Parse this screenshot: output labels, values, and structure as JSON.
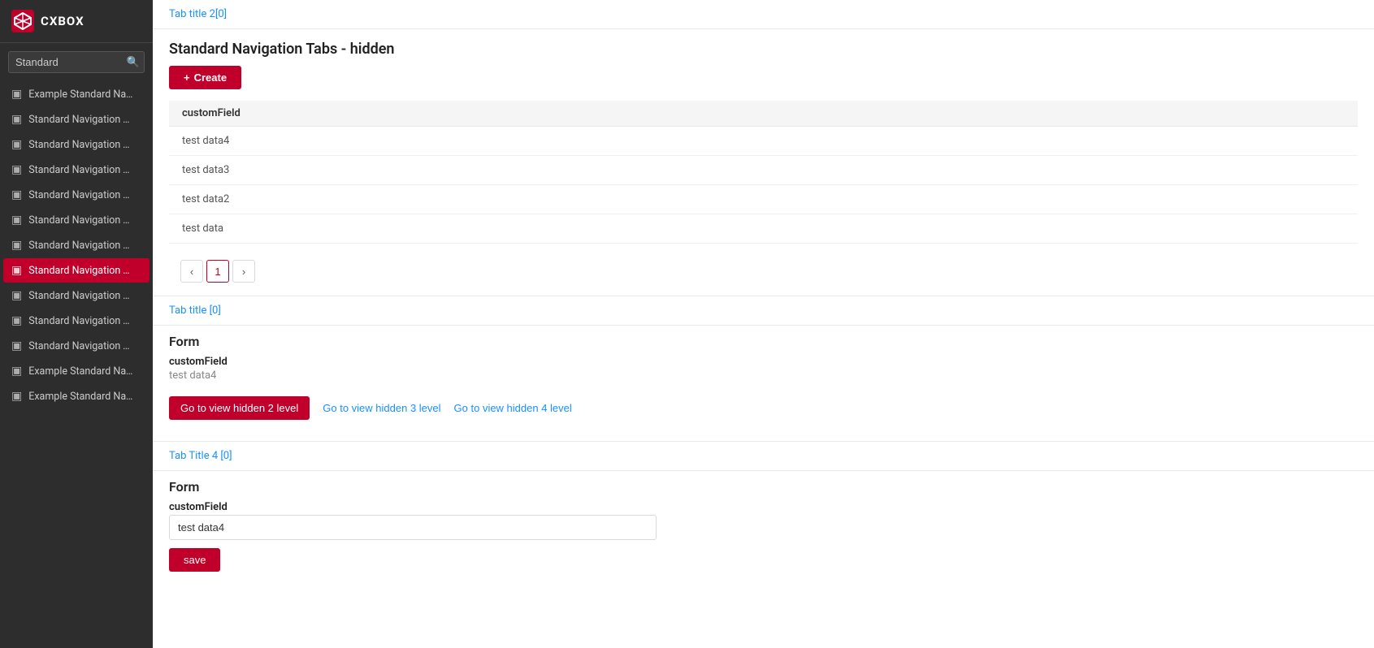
{
  "sidebar": {
    "logo": {
      "text": "CXBOX",
      "icon": "cube-icon"
    },
    "search": {
      "placeholder": "Standard",
      "value": "Standard"
    },
    "items": [
      {
        "id": "item-1",
        "label": "Example Standard Navigati",
        "active": false
      },
      {
        "id": "item-2",
        "label": "Standard Navigation Tabs -",
        "active": false
      },
      {
        "id": "item-3",
        "label": "Standard Navigation Tabs -",
        "active": false
      },
      {
        "id": "item-4",
        "label": "Standard Navigation Tabs -",
        "active": false
      },
      {
        "id": "item-5",
        "label": "Standard Navigation Tabs -",
        "active": false
      },
      {
        "id": "item-6",
        "label": "Standard Navigation Tabs -",
        "active": false
      },
      {
        "id": "item-7",
        "label": "Standard Navigation Tabs -",
        "active": false
      },
      {
        "id": "item-8",
        "label": "Standard Navigation Tabs -",
        "active": true
      },
      {
        "id": "item-9",
        "label": "Standard Navigation Tabs -",
        "active": false
      },
      {
        "id": "item-10",
        "label": "Standard Navigation Tabs -",
        "active": false
      },
      {
        "id": "item-11",
        "label": "Standard Navigation Tabs e",
        "active": false
      },
      {
        "id": "item-12",
        "label": "Example Standard Navigati",
        "active": false
      },
      {
        "id": "item-13",
        "label": "Example Standard Navigati",
        "active": false
      }
    ]
  },
  "main": {
    "tab2_header": "Tab title 2[0]",
    "page_title": "Standard Navigation Tabs - hidden",
    "create_button": "+ Create",
    "list": {
      "columns": [
        "customField"
      ],
      "rows": [
        {
          "customField": "test data4"
        },
        {
          "customField": "test data3"
        },
        {
          "customField": "test data2"
        },
        {
          "customField": "test data"
        }
      ]
    },
    "pagination": {
      "prev": "‹",
      "current": "1",
      "next": "›"
    },
    "form_section1": {
      "tab_title": "Tab title [0]",
      "title": "Form",
      "field_label": "customField",
      "field_value": "test data4"
    },
    "action_buttons": {
      "primary": "Go to view hidden 2 level",
      "secondary1": "Go to view hidden 3 level",
      "secondary2": "Go to view hidden 4 level"
    },
    "form_section2": {
      "tab_title": "Tab Title 4 [0]",
      "title": "Form",
      "field_label": "customField",
      "field_value": "test data4",
      "save_button": "save"
    }
  }
}
